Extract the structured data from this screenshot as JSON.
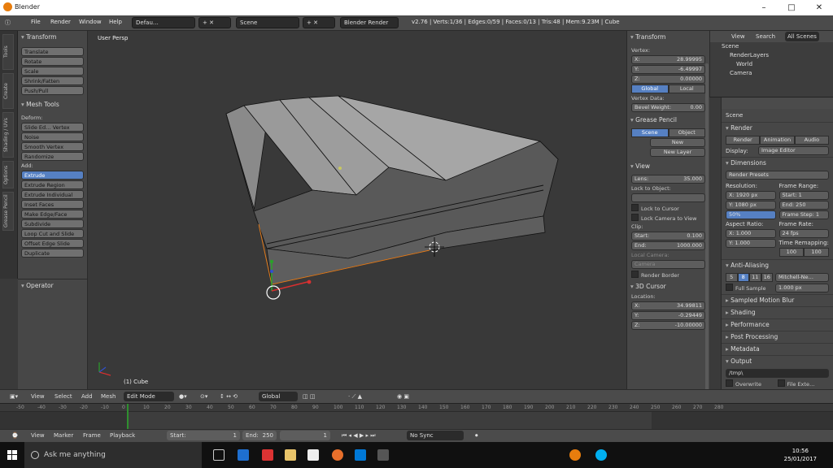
{
  "window": {
    "title": "Blender",
    "min": "–",
    "max": "□",
    "close": "✕"
  },
  "menu": {
    "file": "File",
    "render": "Render",
    "window": "Window",
    "help": "Help"
  },
  "infobar": {
    "layout": "Defau…",
    "scene": "Scene",
    "engine": "Blender Render",
    "stats": "v2.76 | Verts:1/36 | Edges:0/59 | Faces:0/13 | Tris:48 | Mem:9.23M | Cube"
  },
  "lefttabs": [
    "Tools",
    "Create",
    "Shading / UVs",
    "Options",
    "Grease Pencil"
  ],
  "toolshelf": {
    "transform_header": "Transform",
    "transform": [
      "Translate",
      "Rotate",
      "Scale",
      "Shrink/Fatten",
      "Push/Pull"
    ],
    "mesh_tools_header": "Mesh Tools",
    "deform_label": "Deform:",
    "deform": [
      "Slide Ed… Vertex",
      "Noise",
      "Smooth Vertex",
      "Randomize"
    ],
    "add_label": "Add:",
    "add": [
      "Extrude",
      "Extrude Region",
      "Extrude Individual",
      "Inset Faces",
      "Make Edge/Face",
      "Subdivide",
      "Loop Cut and Slide",
      "Offset Edge Slide",
      "Duplicate"
    ],
    "operator_header": "Operator"
  },
  "viewport": {
    "label": "User Persp",
    "object": "(1) Cube"
  },
  "npanel": {
    "transform_header": "Transform",
    "vertex_label": "Vertex:",
    "x": "X:",
    "x_val": "28.99995",
    "y": "Y:",
    "y_val": "-6.49997",
    "z": "Z:",
    "z_val": "0.00000",
    "global": "Global",
    "local": "Local",
    "vertex_data": "Vertex Data:",
    "bevel_weight": "Bevel Weight:",
    "bevel_val": "0.00",
    "grease_header": "Grease Pencil",
    "gp_scene": "Scene",
    "gp_object": "Object",
    "gp_new": "New",
    "gp_new_layer": "New Layer",
    "view_header": "View",
    "lens": "Lens:",
    "lens_val": "35.000",
    "lock_object": "Lock to Object:",
    "lock_cursor": "Lock to Cursor",
    "lock_camera": "Lock Camera to View",
    "clip": "Clip:",
    "start": "Start:",
    "start_val": "0.100",
    "end": "End:",
    "end_val": "1000.000",
    "local_camera": "Local Camera:",
    "camera_val": "Camera",
    "render_border": "Render Border",
    "cursor_header": "3D Cursor",
    "location": "Location:",
    "cx_val": "34.99811",
    "cy_val": "-0.29449",
    "cz_val": "-10.00000"
  },
  "outliner": {
    "view": "View",
    "search": "Search",
    "all_scenes": "All Scenes",
    "rows": [
      "Scene",
      "RenderLayers",
      "World",
      "Camera"
    ]
  },
  "props": {
    "scene": "Scene",
    "render_header": "Render",
    "render_btn": "Render",
    "animation_btn": "Animation",
    "audio_btn": "Audio",
    "display_lbl": "Display:",
    "display_val": "Image Editor",
    "dimensions_header": "Dimensions",
    "render_presets": "Render Presets",
    "resolution": "Resolution:",
    "frame_range": "Frame Range:",
    "res_x": "X: 1920 px",
    "res_y": "Y: 1080 px",
    "res_pct": "50%",
    "start_frame": "Start: 1",
    "end_frame": "End: 250",
    "frame_step": "Frame Step: 1",
    "aspect": "Aspect Ratio:",
    "fps_lbl": "Frame Rate:",
    "asp_x": "X: 1.000",
    "asp_y": "Y: 1.000",
    "fps": "24 fps",
    "time_remap": "Time Remapping:",
    "old": "100",
    "new": "100",
    "aa_header": "Anti-Aliasing",
    "aa_values": [
      "5",
      "8",
      "11",
      "16"
    ],
    "aa_filter": "Mitchell-Ne…",
    "full_sample": "Full Sample",
    "aa_size": "1.000 px",
    "sections": [
      "Sampled Motion Blur",
      "Shading",
      "Performance",
      "Post Processing",
      "Metadata",
      "Output"
    ],
    "output_path": "/tmp\\",
    "overwrite": "Overwrite",
    "file_ext": "File Exte…"
  },
  "view3d_header": {
    "view": "View",
    "select": "Select",
    "add": "Add",
    "mesh": "Mesh",
    "mode": "Edit Mode",
    "orientation": "Global"
  },
  "timeline": {
    "ticks": [
      "-50",
      "-40",
      "-30",
      "-20",
      "-10",
      "0",
      "10",
      "20",
      "30",
      "40",
      "50",
      "60",
      "70",
      "80",
      "90",
      "100",
      "110",
      "120",
      "130",
      "140",
      "150",
      "160",
      "170",
      "180",
      "190",
      "200",
      "210",
      "220",
      "230",
      "240",
      "250",
      "260",
      "270",
      "280"
    ],
    "view": "View",
    "marker": "Marker",
    "frame": "Frame",
    "playback": "Playback",
    "start": "Start:",
    "start_val": "1",
    "end": "End:",
    "end_val": "250",
    "current": "1",
    "sync": "No Sync"
  },
  "taskbar": {
    "search": "Ask me anything",
    "time": "10:56",
    "date": "25/01/2017"
  }
}
